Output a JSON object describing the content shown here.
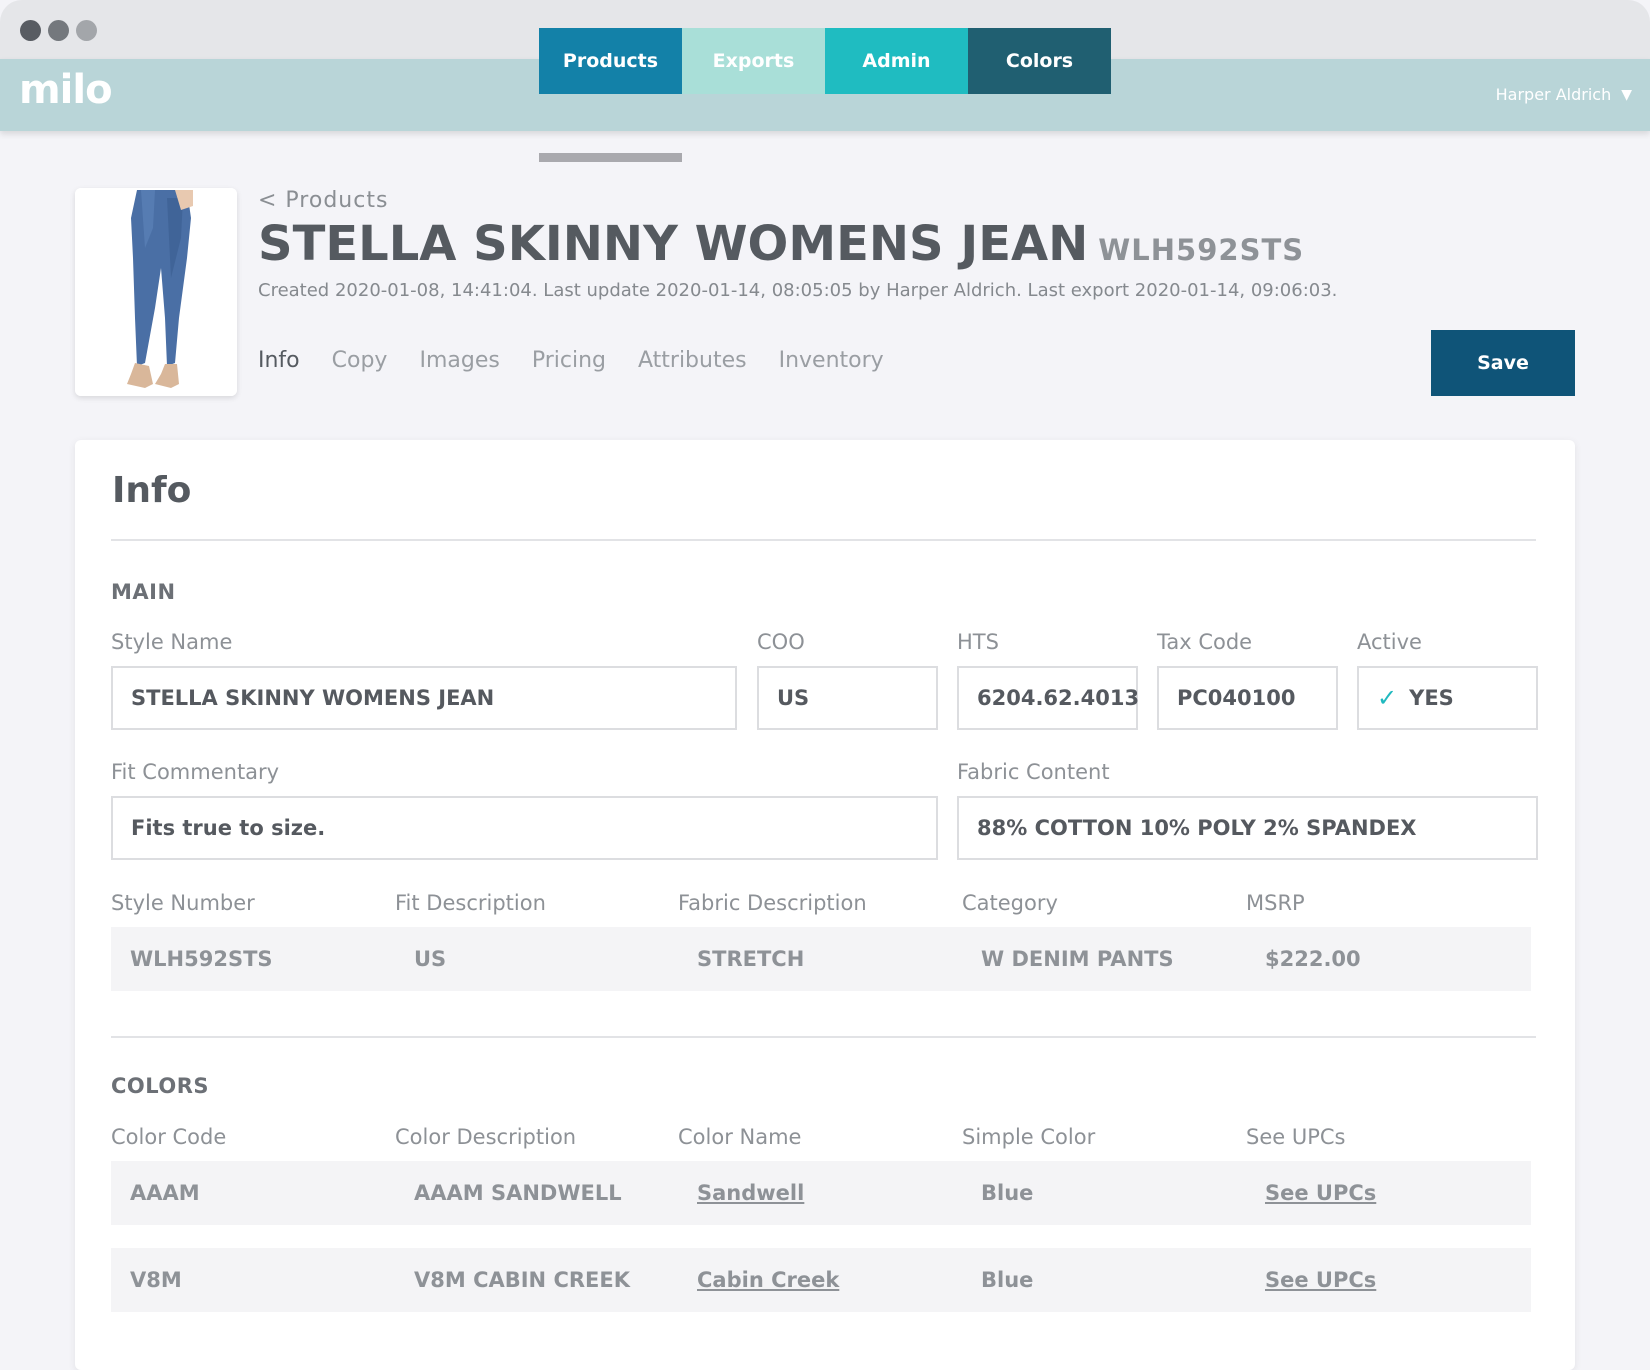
{
  "app": {
    "logo": "milo",
    "user_name": "Harper Aldrich"
  },
  "nav": {
    "tabs": [
      {
        "label": "Products"
      },
      {
        "label": "Exports"
      },
      {
        "label": "Admin"
      },
      {
        "label": "Colors"
      }
    ],
    "active": "Products"
  },
  "product": {
    "breadcrumb": "< Products",
    "title": "STELLA SKINNY WOMENS JEAN",
    "code": "WLH592STS",
    "meta": "Created 2020-01-08, 14:41:04.  Last update 2020-01-14, 08:05:05 by Harper Aldrich. Last export 2020-01-14, 09:06:03."
  },
  "subtabs": [
    "Info",
    "Copy",
    "Images",
    "Pricing",
    "Attributes",
    "Inventory"
  ],
  "save_label": "Save",
  "info": {
    "title": "Info",
    "main_label": "MAIN",
    "fields": {
      "style_name": {
        "label": "Style Name",
        "value": "STELLA SKINNY WOMENS JEAN"
      },
      "coo": {
        "label": "COO",
        "value": "US"
      },
      "hts": {
        "label": "HTS",
        "value": "6204.62.4013"
      },
      "tax_code": {
        "label": "Tax Code",
        "value": "PC040100"
      },
      "active": {
        "label": "Active",
        "value": "YES"
      },
      "fit_commentary": {
        "label": "Fit Commentary",
        "value": "Fits true to size."
      },
      "fabric_content": {
        "label": "Fabric Content",
        "value": "88% COTTON 10% POLY 2% SPANDEX"
      }
    },
    "readonly": {
      "headers": [
        "Style Number",
        "Fit Description",
        "Fabric Description",
        "Category",
        "MSRP"
      ],
      "values": [
        "WLH592STS",
        "US",
        "STRETCH",
        "W DENIM PANTS",
        "$222.00"
      ]
    },
    "colors_label": "COLORS",
    "colors": {
      "headers": [
        "Color Code",
        "Color Description",
        "Color Name",
        "Simple Color",
        "See UPCs"
      ],
      "rows": [
        {
          "code": "AAAM",
          "description": "AAAM SANDWELL",
          "name": "Sandwell",
          "simple": "Blue",
          "upcs": "See UPCs"
        },
        {
          "code": "V8M",
          "description": "V8M CABIN CREEK",
          "name": "Cabin Creek",
          "simple": "Blue",
          "upcs": "See UPCs"
        }
      ]
    }
  },
  "colors_theme": {
    "products_tab": "#1381a8",
    "exports_tab": "#a9dfd8",
    "admin_tab": "#1fbcc1",
    "colors_tab": "#205f71",
    "save_button": "#0f5478"
  }
}
